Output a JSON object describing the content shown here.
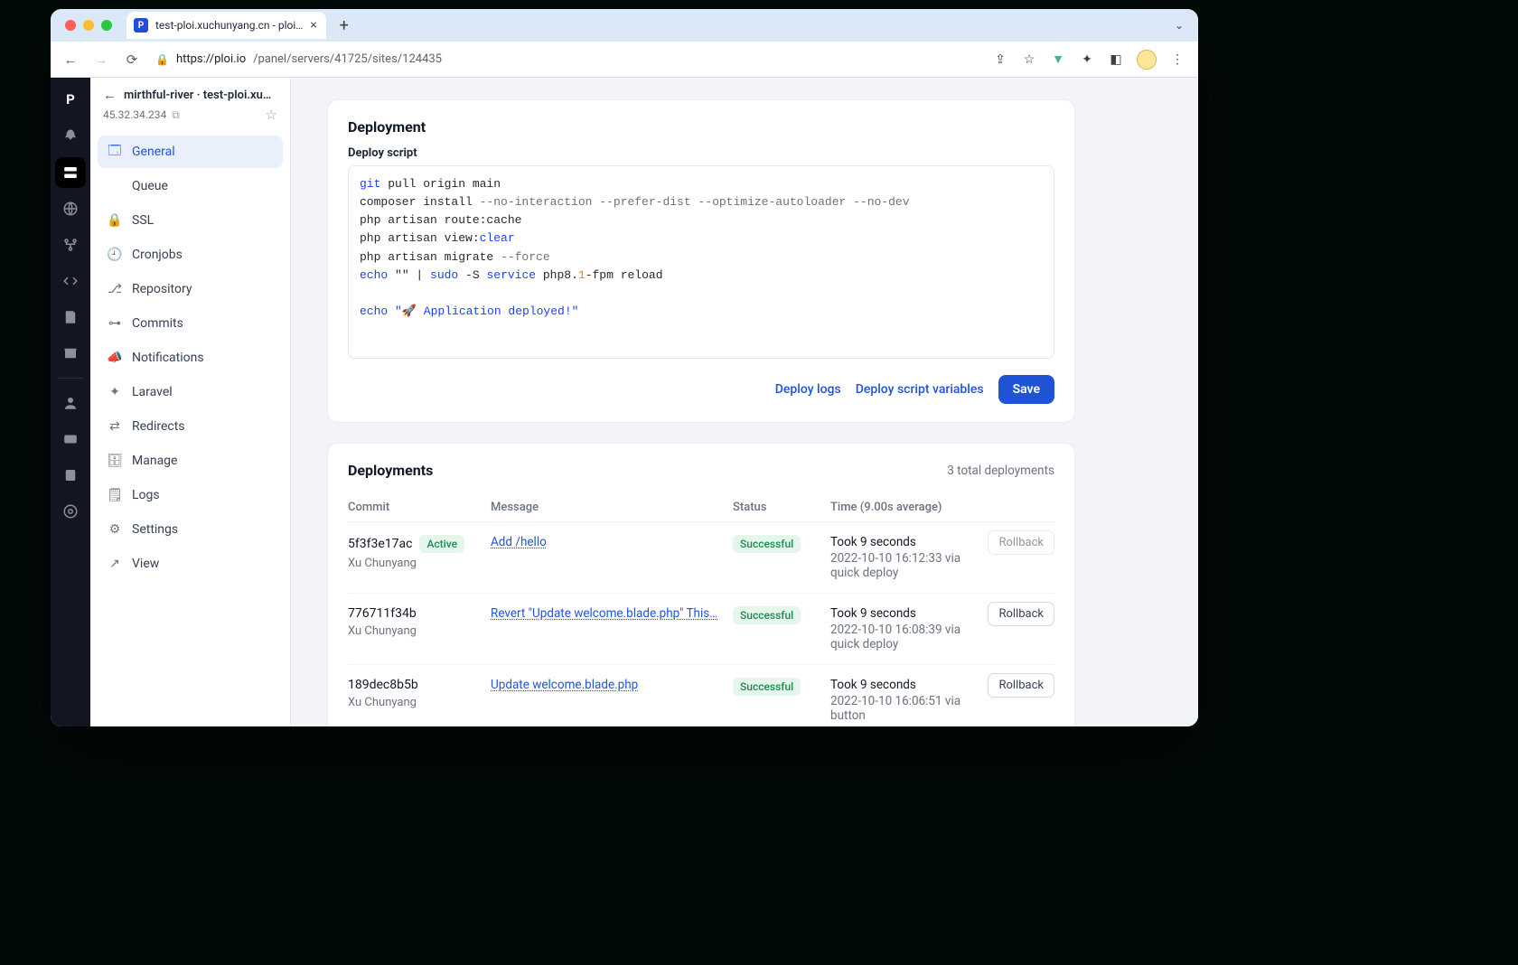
{
  "browser": {
    "tab_title": "test-ploi.xuchunyang.cn - ploi…",
    "url_host": "https://ploi.io",
    "url_path": "/panel/servers/41725/sites/124435"
  },
  "sidebar": {
    "breadcrumb": "mirthful-river · test-ploi.xu…",
    "ip": "45.32.34.234",
    "items": [
      {
        "label": "General"
      },
      {
        "label": "Queue"
      },
      {
        "label": "SSL"
      },
      {
        "label": "Cronjobs"
      },
      {
        "label": "Repository"
      },
      {
        "label": "Commits"
      },
      {
        "label": "Notifications"
      },
      {
        "label": "Laravel"
      },
      {
        "label": "Redirects"
      },
      {
        "label": "Manage"
      },
      {
        "label": "Logs"
      },
      {
        "label": "Settings"
      },
      {
        "label": "View"
      }
    ]
  },
  "deployment": {
    "title": "Deployment",
    "script_label": "Deploy script",
    "deploy_logs": "Deploy logs",
    "deploy_vars": "Deploy script variables",
    "save": "Save",
    "script": {
      "l1a": "git",
      "l1b": " pull origin main",
      "l2": "composer install ",
      "l2o": "--no-interaction --prefer-dist --optimize-autoloader --no-dev",
      "l3": "php artisan route:cache",
      "l4a": "php artisan view:",
      "l4b": "clear",
      "l5a": "php artisan migrate ",
      "l5o": "--force",
      "l6a": "echo",
      "l6b": " \"\"",
      "l6c": " | ",
      "l6d": "sudo",
      "l6e": " -S ",
      "l6f": "service",
      "l6g": " php8.",
      "l6h": "1",
      "l6i": "-fpm reload",
      "l8a": "echo",
      "l8b": " \"🚀 Application deployed!\""
    }
  },
  "deployments": {
    "title": "Deployments",
    "total": "3 total deployments",
    "cols": {
      "commit": "Commit",
      "message": "Message",
      "status": "Status",
      "time_label": "Time",
      "time_avg": "(9.00s average)"
    },
    "badge_active": "Active",
    "rollback": "Rollback",
    "rows": [
      {
        "sha": "5f3f3e17ac",
        "author": "Xu Chunyang",
        "active": true,
        "message": "Add /hello",
        "status": "Successful",
        "took": "Took 9 seconds",
        "meta": "2022-10-10 16:12:33 via quick deploy",
        "rollback_enabled": false
      },
      {
        "sha": "776711f34b",
        "author": "Xu Chunyang",
        "active": false,
        "message": "Revert \"Update welcome.blade.php\" This…",
        "status": "Successful",
        "took": "Took 9 seconds",
        "meta": "2022-10-10 16:08:39 via quick deploy",
        "rollback_enabled": true
      },
      {
        "sha": "189dec8b5b",
        "author": "Xu Chunyang",
        "active": false,
        "message": "Update welcome.blade.php",
        "status": "Successful",
        "took": "Took 9 seconds",
        "meta": "2022-10-10 16:06:51 via button",
        "rollback_enabled": true
      }
    ]
  }
}
